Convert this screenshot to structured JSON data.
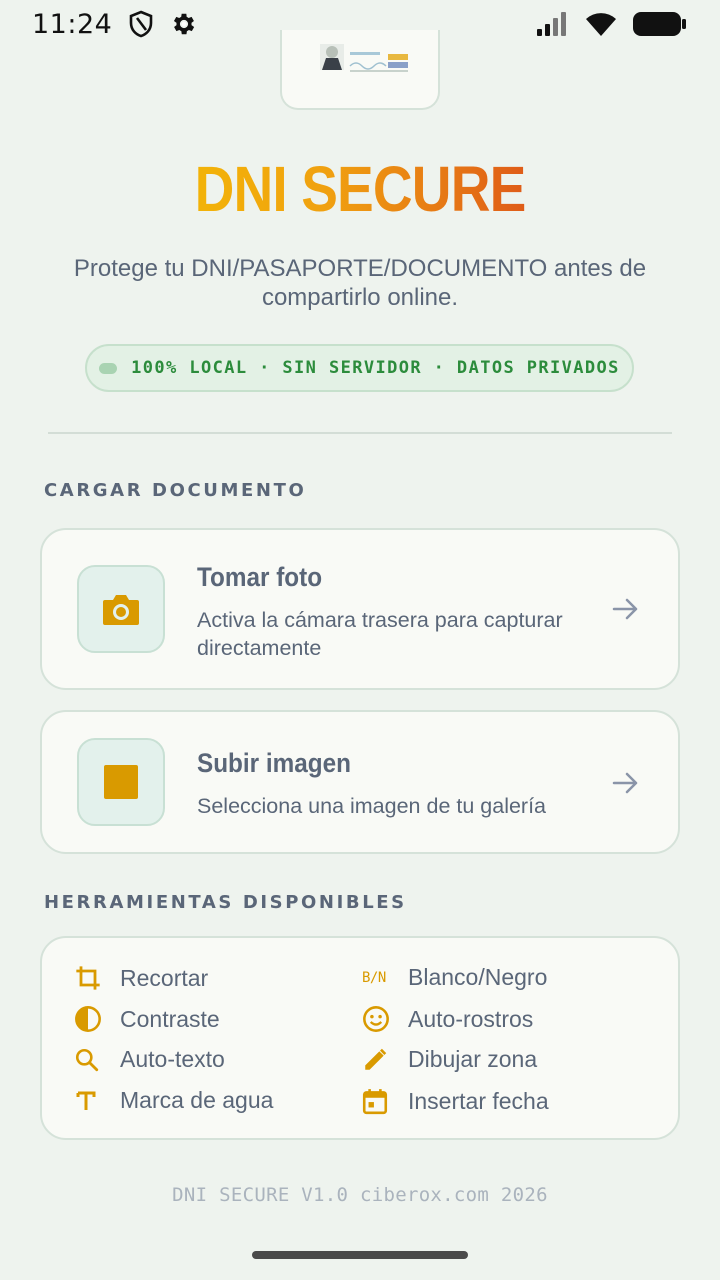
{
  "status_bar": {
    "time": "11:24"
  },
  "app": {
    "title": "DNI SECURE",
    "subtitle": "Protege tu DNI/PASAPORTE/DOCUMENTO antes de compartirlo online.",
    "badge": "100% LOCAL · SIN SERVIDOR · DATOS PRIVADOS"
  },
  "upload_section": {
    "label": "CARGAR DOCUMENTO",
    "actions": [
      {
        "title": "Tomar foto",
        "description": "Activa la cámara trasera para capturar directamente",
        "icon": "camera-icon"
      },
      {
        "title": "Subir imagen",
        "description": "Selecciona una imagen de tu galería",
        "icon": "image-icon"
      }
    ]
  },
  "tools_section": {
    "label": "HERRAMIENTAS DISPONIBLES",
    "tools": [
      {
        "label": "Recortar",
        "icon": "crop-icon"
      },
      {
        "label": "Blanco/Negro",
        "icon": "bw-icon",
        "icon_text": "B/N"
      },
      {
        "label": "Contraste",
        "icon": "contrast-icon"
      },
      {
        "label": "Auto-rostros",
        "icon": "face-icon"
      },
      {
        "label": "Auto-texto",
        "icon": "search-icon"
      },
      {
        "label": "Dibujar zona",
        "icon": "pencil-icon"
      },
      {
        "label": "Marca de agua",
        "icon": "text-icon"
      },
      {
        "label": "Insertar fecha",
        "icon": "calendar-icon"
      }
    ]
  },
  "footer": {
    "text": "DNI SECURE V1.0 ciberox.com 2026"
  },
  "colors": {
    "accent": "#d99a00",
    "text": "#5a6678",
    "badge_text": "#2c8c3c",
    "background": "#eef3ee"
  }
}
